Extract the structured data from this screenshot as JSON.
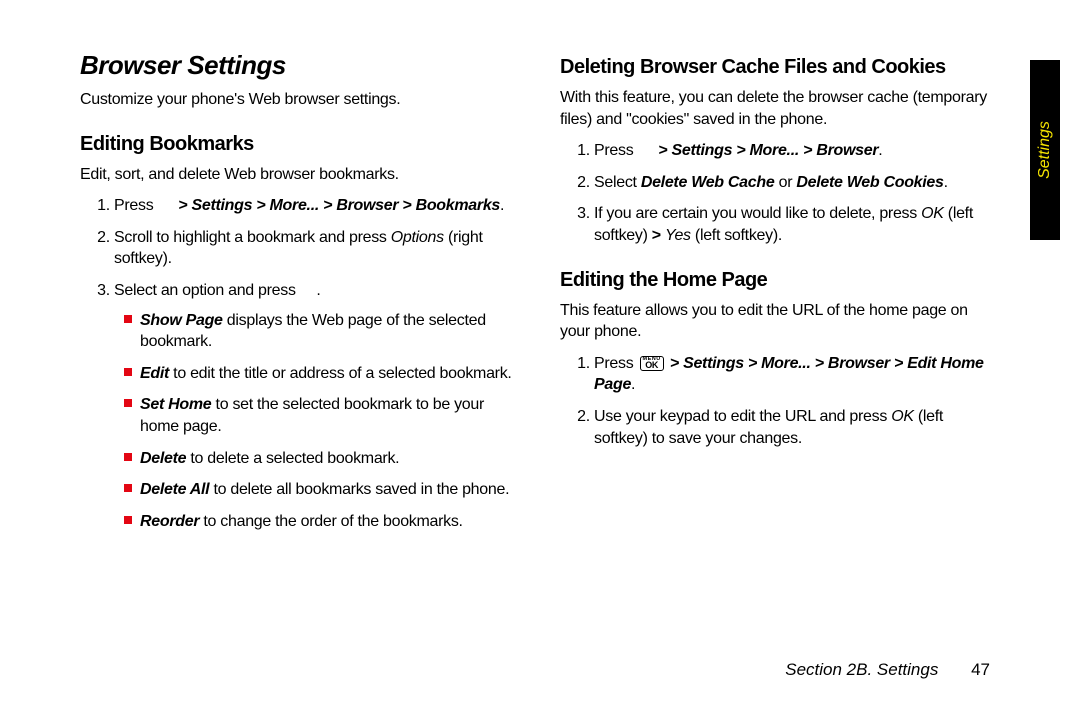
{
  "sideTab": "Settings",
  "left": {
    "h1": "Browser Settings",
    "intro": "Customize your phone's Web browser settings.",
    "h2": "Editing Bookmarks",
    "sub": "Edit, sort, and delete Web browser bookmarks.",
    "ol1_press": "Press",
    "ol1_path": " > Settings > More... > Browser > Bookmarks",
    "ol2_a": "Scroll to highlight a bookmark and press ",
    "ol2_opt": "Options",
    "ol2_b": " (right softkey).",
    "ol3_a": "Select an option and press ",
    "ol3_b": ".",
    "b1_s": "Show Page",
    "b1_t": " displays the Web page of the selected bookmark.",
    "b2_s": "Edit",
    "b2_t": " to edit the title or address of a selected bookmark.",
    "b3_s": "Set Home",
    "b3_t": " to set the selected bookmark to be your home page.",
    "b4_s": "Delete",
    "b4_t": " to delete a selected bookmark.",
    "b5_s": "Delete All",
    "b5_t": " to delete all bookmarks saved in the phone.",
    "b6_s": "Reorder",
    "b6_t": " to change the order of the bookmarks."
  },
  "right": {
    "h2a": "Deleting Browser Cache Files and Cookies",
    "pa": "With this feature, you can delete the browser cache (temporary files) and \"cookies\" saved in the phone.",
    "a1_press": "Press",
    "a1_path": " > Settings > More... > Browser",
    "a1_end": ".",
    "a2_a": "Select ",
    "a2_opt1": "Delete Web Cache",
    "a2_or": " or ",
    "a2_opt2": "Delete Web Cookies",
    "a2_end": ".",
    "a3_a": "If you are certain you would like to delete, press ",
    "a3_ok": "OK",
    "a3_b": " (left softkey) ",
    "a3_gt": "> ",
    "a3_yes": "Yes",
    "a3_c": " (left softkey).",
    "h2b": "Editing the Home Page",
    "pb": "This feature allows you to edit the URL of the home page on your phone.",
    "b1_press": "Press ",
    "b1_path": " > Settings > More... > Browser > Edit Home Page",
    "b1_end": ".",
    "b2_a": "Use your keypad to edit the URL and press ",
    "b2_ok": "OK",
    "b2_b": " (left softkey) to save your changes."
  },
  "footer": {
    "section": "Section 2B. Settings",
    "page": "47"
  },
  "okkey": {
    "menu": "MENU",
    "ok": "OK"
  }
}
